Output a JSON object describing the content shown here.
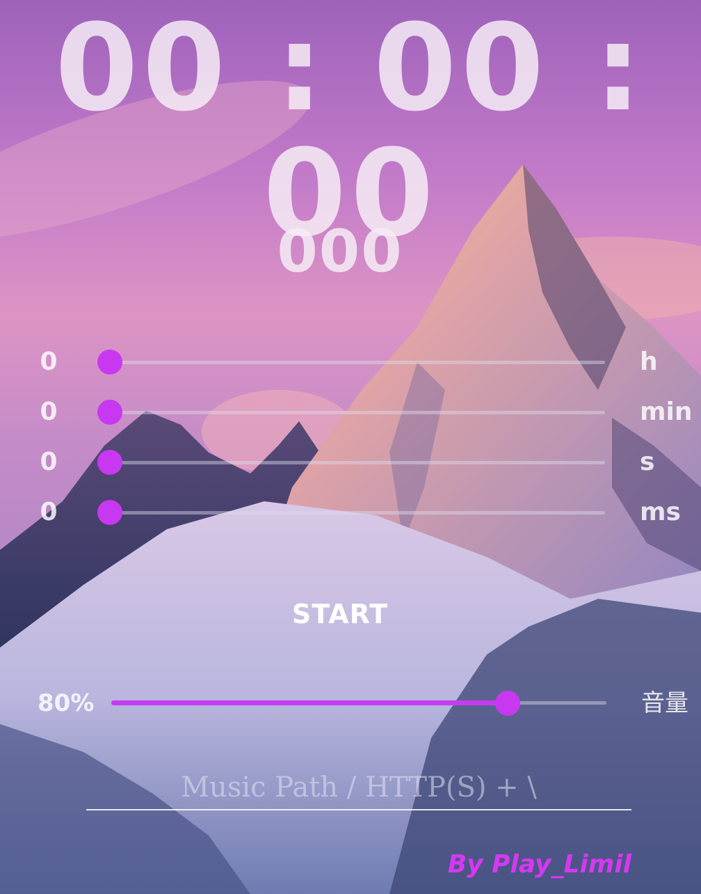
{
  "timer": {
    "display": "00 : 00 : 00",
    "milliseconds": "000"
  },
  "sliders": [
    {
      "value": "0",
      "unit": "h",
      "level": 0
    },
    {
      "value": "0",
      "unit": "min",
      "level": 0
    },
    {
      "value": "0",
      "unit": "s",
      "level": 0
    },
    {
      "value": "0",
      "unit": "ms",
      "level": 0
    }
  ],
  "start_label": "START",
  "volume": {
    "value_label": "80%",
    "level": 0.8,
    "label": "音量"
  },
  "music_input": {
    "value": "",
    "placeholder": "Music Path / HTTP(S) + \\"
  },
  "credit": "By Play_Limil",
  "colors": {
    "accent": "#c838f0",
    "credit": "#d638f2"
  }
}
